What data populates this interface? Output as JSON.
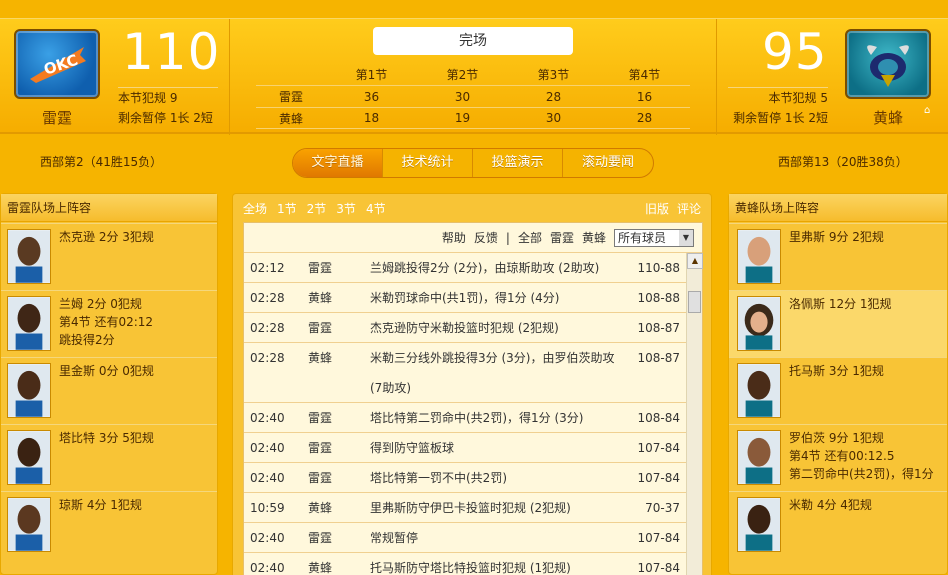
{
  "game": {
    "status": "完场",
    "home": {
      "name": "雷霆",
      "score": "110",
      "fouls": "本节犯规 9",
      "timeouts": "剩余暂停 1长 2短",
      "standing": "西部第2（41胜15负）",
      "color": "#0f5fae",
      "logo_text": "OKC"
    },
    "away": {
      "name": "黄蜂",
      "score": "95",
      "fouls": "本节犯规 5",
      "timeouts": "剩余暂停 1长 2短",
      "standing": "西部第13（20胜38负）",
      "color": "#0d6f86"
    },
    "quarter_headers": [
      "第1节",
      "第2节",
      "第3节",
      "第4节"
    ],
    "quarter_rows": [
      {
        "team": "雷霆",
        "scores": [
          "36",
          "30",
          "28",
          "16"
        ]
      },
      {
        "team": "黄蜂",
        "scores": [
          "18",
          "19",
          "30",
          "28"
        ]
      }
    ]
  },
  "tabs": [
    {
      "label": "文字直播",
      "active": true
    },
    {
      "label": "技术统计",
      "active": false
    },
    {
      "label": "投篮演示",
      "active": false
    },
    {
      "label": "滚动要闻",
      "active": false
    }
  ],
  "left_roster": {
    "title": "雷霆队场上阵容",
    "players": [
      {
        "line1": "杰克逊  2分  3犯规",
        "line2": "",
        "line3": ""
      },
      {
        "line1": "兰姆  2分  0犯规",
        "line2": "第4节 还有02:12",
        "line3": "跳投得2分"
      },
      {
        "line1": "里金斯  0分  0犯规",
        "line2": "",
        "line3": ""
      },
      {
        "line1": "塔比特  3分  5犯规",
        "line2": "",
        "line3": ""
      },
      {
        "line1": "琼斯  4分  1犯规",
        "line2": "",
        "line3": ""
      }
    ]
  },
  "right_roster": {
    "title": "黄蜂队场上阵容",
    "players": [
      {
        "line1": "里弗斯  9分  2犯规",
        "line2": "",
        "line3": ""
      },
      {
        "line1": "洛佩斯  12分  1犯规",
        "line2": "",
        "line3": ""
      },
      {
        "line1": "托马斯  3分  1犯规",
        "line2": "",
        "line3": ""
      },
      {
        "line1": "罗伯茨  9分  1犯规",
        "line2": "第4节 还有00:12.5",
        "line3": "第二罚命中(共2罚)，得1分"
      },
      {
        "line1": "米勒  4分  4犯规",
        "line2": "",
        "line3": ""
      }
    ]
  },
  "feed": {
    "quarter_nav": [
      "全场",
      "1节",
      "2节",
      "3节",
      "4节"
    ],
    "top_links": [
      "旧版",
      "评论"
    ],
    "filters": [
      "帮助",
      "反馈",
      "|",
      "全部",
      "雷霆",
      "黄蜂"
    ],
    "select_value": "所有球员",
    "rows": [
      {
        "time": "02:12",
        "team": "雷霆",
        "event": "兰姆跳投得2分 (2分)，由琼斯助攻 (2助攻)",
        "score": "110-88"
      },
      {
        "time": "02:28",
        "team": "黄蜂",
        "event": "米勒罚球命中(共1罚)，得1分 (4分)",
        "score": "108-88"
      },
      {
        "time": "02:28",
        "team": "雷霆",
        "event": "杰克逊防守米勒投篮时犯规 (2犯规)",
        "score": "108-87"
      },
      {
        "time": "02:28",
        "team": "黄蜂",
        "event": "米勒三分线外跳投得3分 (3分)，由罗伯茨助攻 (7助攻)",
        "score": "108-87"
      },
      {
        "time": "02:40",
        "team": "雷霆",
        "event": "塔比特第二罚命中(共2罚)，得1分 (3分)",
        "score": "108-84"
      },
      {
        "time": "02:40",
        "team": "雷霆",
        "event": "得到防守篮板球",
        "score": "107-84"
      },
      {
        "time": "02:40",
        "team": "雷霆",
        "event": "塔比特第一罚不中(共2罚)",
        "score": "107-84"
      },
      {
        "time": "10:59",
        "team": "黄蜂",
        "event": "里弗斯防守伊巴卡投篮时犯规 (2犯规)",
        "score": "70-37"
      },
      {
        "time": "02:40",
        "team": "雷霆",
        "event": "常规暂停",
        "score": "107-84"
      },
      {
        "time": "02:40",
        "team": "黄蜂",
        "event": "托马斯防守塔比特投篮时犯规 (1犯规)",
        "score": "107-84"
      }
    ]
  }
}
